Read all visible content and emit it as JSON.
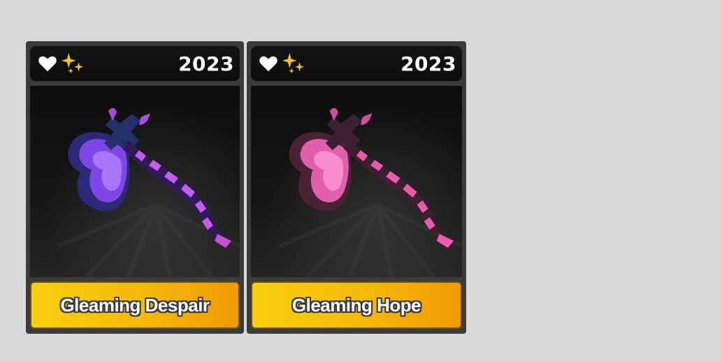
{
  "items": [
    {
      "name": "Gleaming Despair",
      "year": "2023",
      "icons": [
        "heart-icon",
        "sparkle-icon"
      ],
      "colors": {
        "blade_dark": "#2c2a78",
        "blade_mid": "#7e46e6",
        "blade_light": "#b885ff",
        "handle_stripe": "#c35ce8",
        "handle_dark": "#301a5a",
        "tip": "#c64fd9"
      }
    },
    {
      "name": "Gleaming Hope",
      "year": "2023",
      "icons": [
        "heart-icon",
        "sparkle-icon"
      ],
      "colors": {
        "blade_dark": "#4a2236",
        "blade_mid": "#e25fae",
        "blade_light": "#ff9ed6",
        "handle_stripe": "#e85aa9",
        "handle_dark": "#3e1f32",
        "tip": "#f25ab5"
      }
    }
  ],
  "theme": {
    "background": "#d9d9d9",
    "card_frame": "#3b3b3b",
    "label_gradient_start": "#f8cf10",
    "label_gradient_end": "#f29a05"
  }
}
